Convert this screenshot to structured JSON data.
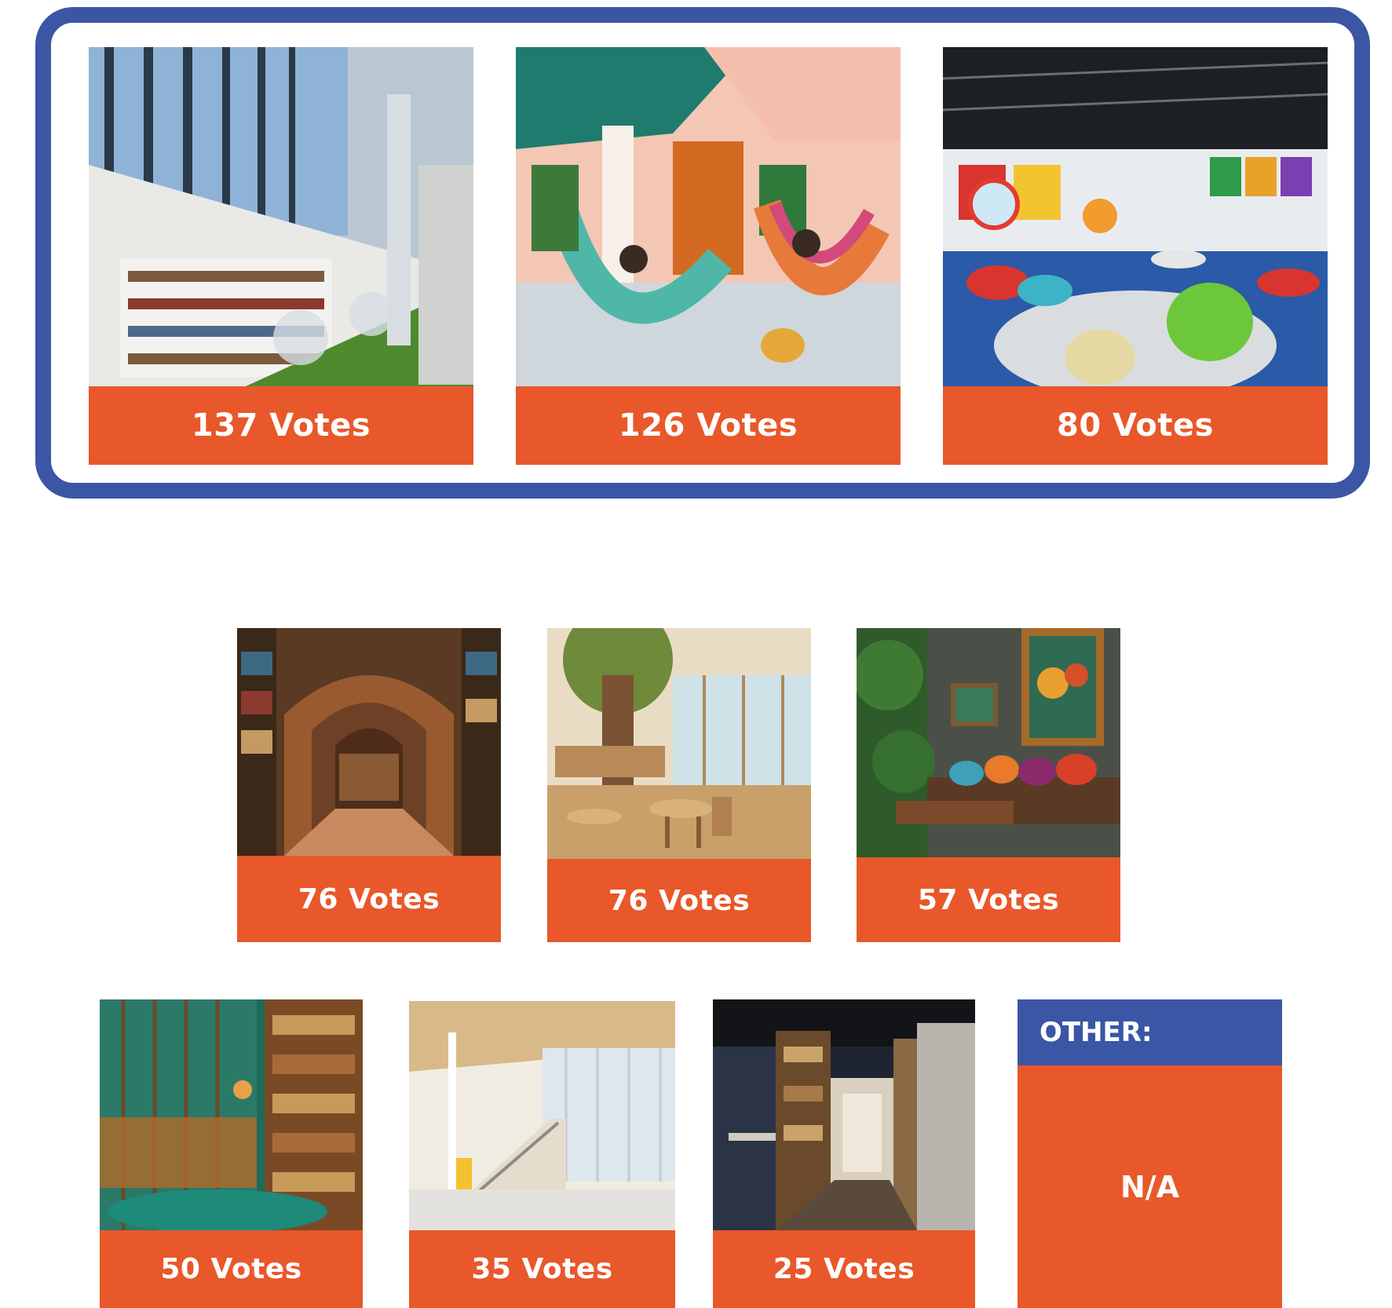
{
  "top_results": [
    {
      "votes": "137 Votes",
      "photo": "curved-glass-library-photo"
    },
    {
      "votes": "126 Votes",
      "photo": "hammock-lounge-photo"
    },
    {
      "votes": "80 Votes",
      "photo": "colorful-pod-chairs-photo"
    }
  ],
  "middle_results": [
    {
      "votes": "76 Votes",
      "photo": "arched-wooden-library-photo"
    },
    {
      "votes": "76 Votes",
      "photo": "tree-children-library-photo"
    },
    {
      "votes": "57 Votes",
      "photo": "plant-cafe-lounge-photo"
    }
  ],
  "bottom_results": [
    {
      "votes": "50 Votes",
      "photo": "green-glass-bookshelf-photo"
    },
    {
      "votes": "35 Votes",
      "photo": "bright-atrium-stairs-photo"
    },
    {
      "votes": "25 Votes",
      "photo": "dark-corridor-library-photo"
    }
  ],
  "other": {
    "heading": "OTHER:",
    "value": "N/A"
  },
  "colors": {
    "accent_orange": "#e8582a",
    "frame_blue": "#3a56a4"
  }
}
